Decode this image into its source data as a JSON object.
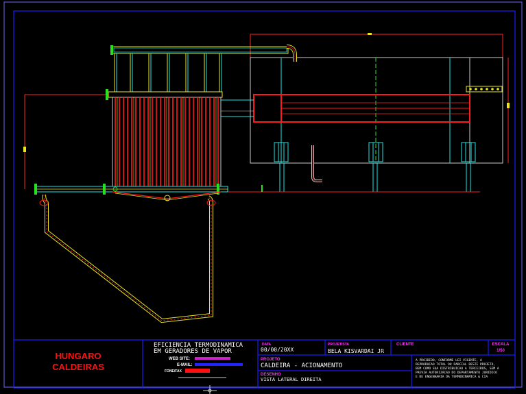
{
  "title_block": {
    "company_line1": "HUNGARO",
    "company_line2": "CALDEIRAS",
    "slogan_line1": "EFICIENCIA TERMODINAMICA",
    "slogan_line2": "EM GERADORES DE VAPOR",
    "web_label": "WEB SITE:",
    "email_label": "E-MAIL:",
    "phone_label": "FONE/FAX",
    "date_label": "DATA",
    "date_value": "00/00/20XX",
    "designer_label": "PROJETISTA",
    "designer_value": "BELA KISVARDAI JR",
    "client_label": "CLIENTE",
    "scale_label": "ESCALA",
    "scale_value": "1/50",
    "project_label": "PROJETO",
    "project_value": "CALDEIRA - ACIONAMENTO",
    "view_label": "DESENHO",
    "view_value": "VISTA LATERAL DIREITA",
    "notice_lines": [
      "A PROIBIDO, CONFORME LEI VIGENTE, A",
      "REPRODUCAO TOTAL OU PARCIAL DESTE PROJETO,",
      "BEM COMO SUA DISTRIBUICAO A TERCEIROS, SEM A",
      "PREVIA AUTORIZACAO DO DEPARTAMENTO JURIDICO",
      "E DE ENGENHARIA DA TERMODINAMICA & CIA"
    ]
  },
  "colors": {
    "background": "#000000",
    "frame": "#1a1aff",
    "company": "#ff1010",
    "structure": "#ff1a1a",
    "pipe_green": "#27e01f",
    "pipe_yellow": "#e8e820",
    "pipe_cyan": "#21e6e6",
    "dimension": "#ff2222",
    "text_white": "#ffffff",
    "label_magenta": "#ff33ff"
  }
}
